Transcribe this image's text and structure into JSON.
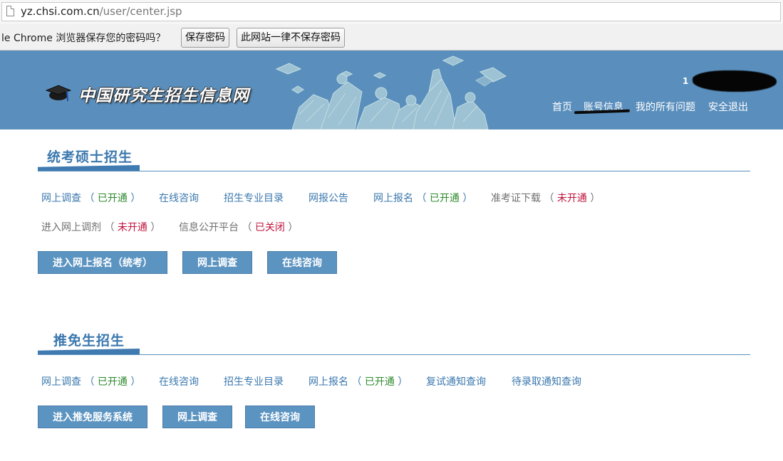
{
  "browser": {
    "url_host": "yz.chsi.com.cn",
    "url_path": "/user/center.jsp",
    "page_icon": "page-icon"
  },
  "infobar": {
    "text": "le Chrome 浏览器保存您的密码吗？",
    "save_label": "保存密码",
    "never_label": "此网站一律不保存密码"
  },
  "header": {
    "site_title": "中国研究生招生信息网",
    "user_id_prefix": "1",
    "nav": [
      "首页",
      "账号信息",
      "我的所有问题",
      "安全退出"
    ],
    "bg_color": "#5a8fbd"
  },
  "section1": {
    "title": "统考硕士招生",
    "links": [
      {
        "label": "网上调查",
        "status": "已开通"
      },
      {
        "label": "在线咨询"
      },
      {
        "label": "招生专业目录"
      },
      {
        "label": "网报公告"
      },
      {
        "label": "网上报名",
        "status": "已开通"
      },
      {
        "label": "准考证下载",
        "status": "未开通"
      },
      {
        "label": "进入网上调剂",
        "status": "未开通"
      },
      {
        "label": "信息公开平台",
        "status": "已关闭"
      }
    ],
    "buttons": [
      "进入网上报名（统考）",
      "网上调查",
      "在线咨询"
    ]
  },
  "section2": {
    "title": "推免生招生",
    "links": [
      {
        "label": "网上调查",
        "status": "已开通"
      },
      {
        "label": "在线咨询"
      },
      {
        "label": "招生专业目录"
      },
      {
        "label": "网上报名",
        "status": "已开通"
      },
      {
        "label": "复试通知查询"
      },
      {
        "label": "待录取通知查询"
      }
    ],
    "buttons": [
      "进入推免服务系统",
      "网上调查",
      "在线咨询"
    ]
  },
  "colors": {
    "accent": "#3b78ae",
    "open": "#2e8a2e",
    "closed": "#c0143c",
    "button": "#5b93c1"
  }
}
